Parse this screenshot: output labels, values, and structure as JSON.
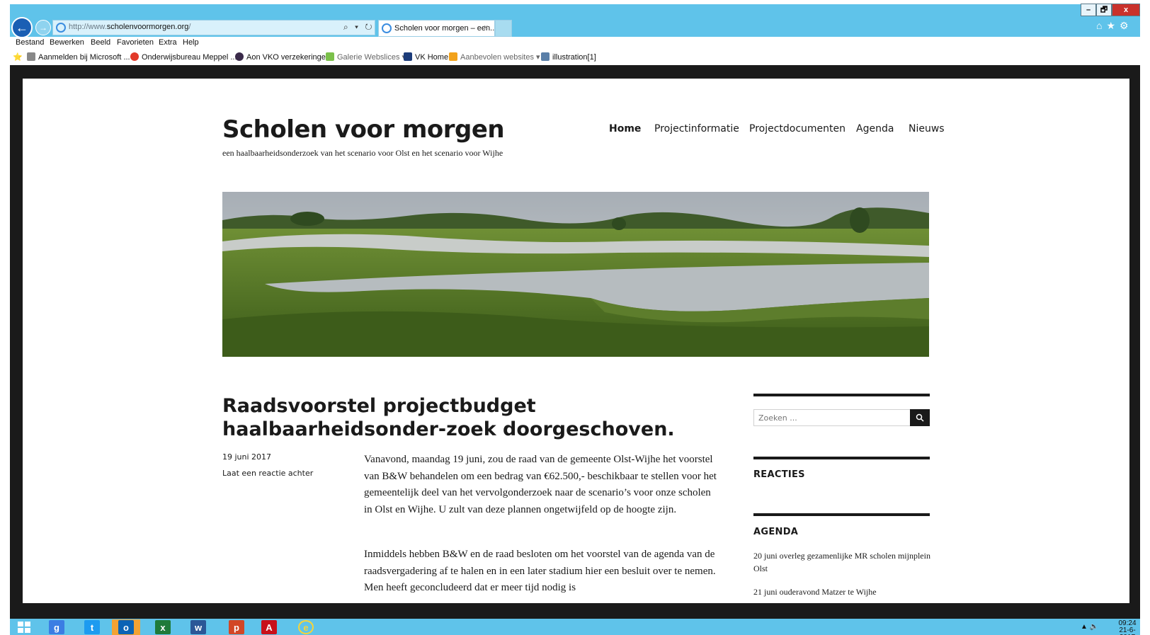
{
  "browser": {
    "url_prefix": "http://www.",
    "url_domain": "scholenvoormorgen.org",
    "url_suffix": "/",
    "address_tools": "⌕ ▾ ↻",
    "tab_title": "Scholen voor morgen – een...",
    "tab_close": "×",
    "window_controls": {
      "minimize": "–",
      "restore": "🗗",
      "close": "x"
    },
    "right_icons": "⌂★⚙"
  },
  "menu": [
    "Bestand",
    "Bewerken",
    "Beeld",
    "Favorieten",
    "Extra",
    "Help"
  ],
  "favorites": [
    {
      "label": "Aanmelden bij Microsoft ...",
      "icon": "microsoft-icon"
    },
    {
      "label": "Onderwijsbureau Meppel ...",
      "icon": "meppel-icon"
    },
    {
      "label": "Aon  VKO verzekeringen",
      "icon": "aon-icon"
    },
    {
      "label": "Galerie Webslices ▾",
      "icon": "webslice-icon"
    },
    {
      "label": "VK Home",
      "icon": "vk-icon"
    },
    {
      "label": "Aanbevolen websites ▾",
      "icon": "bing-icon"
    },
    {
      "label": "illustration[1]",
      "icon": "image-icon"
    }
  ],
  "site": {
    "title": "Scholen voor morgen",
    "description": "een haalbaarheidsonderzoek van het scenario voor Olst en het scenario voor Wijhe",
    "nav": [
      "Home",
      "Projectinformatie",
      "Projectdocumenten",
      "Agenda",
      "Nieuws"
    ]
  },
  "post": {
    "title": "Raadsvoorstel projectbudget haalbaarheidsonder-zoek doorgeschoven.",
    "date": "19 juni 2017",
    "reply": "Laat een reactie achter",
    "para1": "Vanavond, maandag 19 juni, zou de raad van de gemeente Olst-Wijhe het voorstel van B&W behandelen om een bedrag van €62.500,- beschikbaar te stellen voor het gemeentelijk deel van het vervolgonderzoek naar de scenario’s voor onze scholen in Olst en Wijhe. U zult van deze plannen ongetwijfeld op de hoogte zijn.",
    "para2": "Inmiddels hebben B&W en de raad besloten om het voorstel van de agenda van de raadsvergadering af te halen en in een later stadium hier een besluit over te nemen. Men heeft geconcludeerd dat er meer tijd nodig is"
  },
  "sidebar": {
    "search_placeholder": "Zoeken ...",
    "reacties_title": "REACTIES",
    "agenda_title": "AGENDA",
    "agenda_items": [
      "20 juni overleg gezamenlijke MR scholen mijnplein Olst",
      "21 juni ouderavond Matzer te Wijhe"
    ]
  },
  "taskbar": {
    "apps": [
      "windows-start",
      "google",
      "twitter",
      "outlook",
      "excel",
      "word",
      "powerpoint",
      "acrobat",
      "internet-explorer"
    ],
    "tray": "▲  🔈",
    "time": "09:24",
    "date": "21-6-2017"
  },
  "colors": {
    "chrome": "#5fc3ea",
    "text": "#1a1a1a",
    "frame": "#1a1a1a"
  }
}
